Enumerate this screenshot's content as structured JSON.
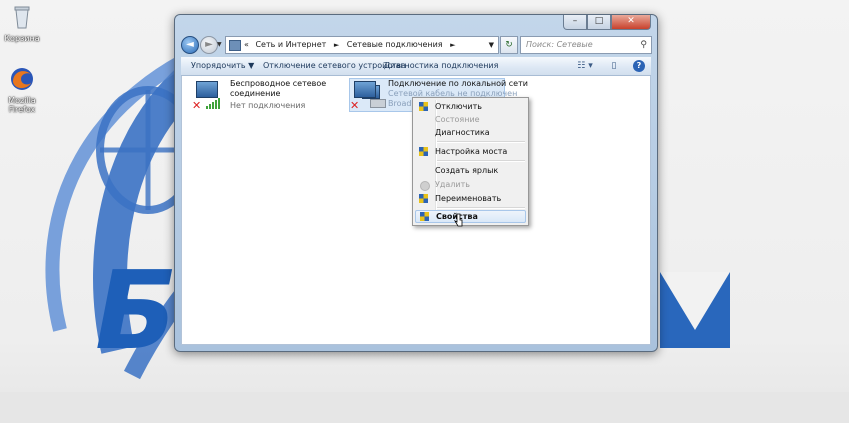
{
  "desktop": {
    "icons": [
      {
        "label": "Корзина",
        "icon": "recycle-bin-icon"
      },
      {
        "label": "Mozilla Firefox",
        "icon": "firefox-icon"
      }
    ],
    "watermark_text": "БЕ"
  },
  "window": {
    "caption_buttons": {
      "minimize": "–",
      "maximize": "□",
      "close": "✕"
    },
    "nav": {
      "back": "◄",
      "forward": "►",
      "history_dropdown": "▼"
    },
    "address": {
      "prefix": "«",
      "crumbs": [
        "Сеть и Интернет",
        "Сетевые подключения"
      ],
      "separator": "►",
      "dropdown": "▼"
    },
    "refresh_glyph": "↻",
    "search": {
      "placeholder": "Поиск: Сетевые подключения",
      "glyph": "⚲"
    },
    "toolbar": {
      "organize": "Упорядочить ▼",
      "disable_device": "Отключение сетевого устройства",
      "diagnose": "Диагностика подключения",
      "view_glyph": "☷ ▾",
      "pane_glyph": "▯",
      "help_glyph": "?"
    },
    "connections": [
      {
        "name_line1": "Беспроводное сетевое",
        "name_line2": "соединение",
        "status": "Нет подключения",
        "icon": "wireless-network-icon"
      },
      {
        "name_line1": "Подключение по локальной сети",
        "status": "Сетевой кабель не подключен",
        "device": "Broadcom",
        "icon": "lan-network-icon"
      }
    ]
  },
  "context_menu": {
    "items": [
      {
        "label": "Отключить",
        "shield": true,
        "disabled": false
      },
      {
        "label": "Состояние",
        "shield": false,
        "disabled": true
      },
      {
        "label": "Диагностика",
        "shield": false,
        "disabled": false
      },
      {
        "label": "Настройка моста",
        "shield": true,
        "disabled": false
      },
      {
        "label": "Создать ярлык",
        "shield": false,
        "disabled": false
      },
      {
        "label": "Удалить",
        "shield": false,
        "disabled": true
      },
      {
        "label": "Переименовать",
        "shield": true,
        "disabled": false
      },
      {
        "label": "Свойства",
        "shield": true,
        "disabled": false,
        "highlighted": true
      }
    ]
  },
  "colors": {
    "accent": "#1e5fb8",
    "shield_blue": "#2b63b5",
    "shield_yellow": "#e8c21a",
    "error_red": "#d22222"
  }
}
